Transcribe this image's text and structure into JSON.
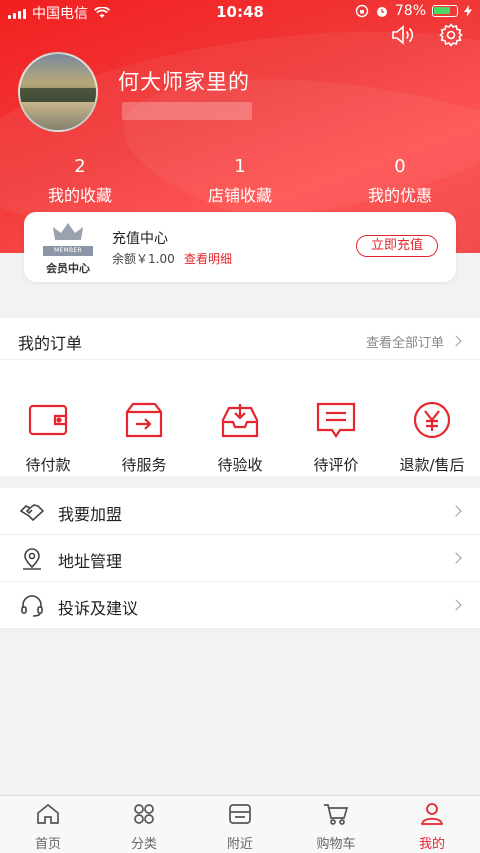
{
  "status_bar": {
    "carrier": "中国电信",
    "time": "10:48",
    "battery": "78%",
    "battery_level": 0.78
  },
  "profile": {
    "username": "何大师家里的"
  },
  "stats": [
    {
      "num": "2",
      "label": "我的收藏"
    },
    {
      "num": "1",
      "label": "店铺收藏"
    },
    {
      "num": "0",
      "label": "我的优惠"
    }
  ],
  "member_card": {
    "ribbon": "MEMBER",
    "label": "会员中心",
    "title": "充值中心",
    "balance": "余额￥1.00",
    "detail_link": "查看明细",
    "recharge_button": "立即充值"
  },
  "orders": {
    "title": "我的订单",
    "view_all": "查看全部订单",
    "items": [
      {
        "label": "待付款",
        "icon": "wallet-icon"
      },
      {
        "label": "待服务",
        "icon": "service-box-icon"
      },
      {
        "label": "待验收",
        "icon": "inbox-download-icon"
      },
      {
        "label": "待评价",
        "icon": "comment-icon"
      },
      {
        "label": "退款/售后",
        "icon": "yen-circle-icon"
      }
    ]
  },
  "menu": [
    {
      "label": "我要加盟",
      "icon": "handshake-icon"
    },
    {
      "label": "地址管理",
      "icon": "location-pin-icon"
    },
    {
      "label": "投诉及建议",
      "icon": "headset-icon"
    }
  ],
  "tabbar": [
    {
      "label": "首页",
      "icon": "home-icon"
    },
    {
      "label": "分类",
      "icon": "category-grid-icon"
    },
    {
      "label": "附近",
      "icon": "nearby-shop-icon"
    },
    {
      "label": "购物车",
      "icon": "cart-icon"
    },
    {
      "label": "我的",
      "icon": "user-icon",
      "active": true
    }
  ],
  "colors": {
    "accent": "#e5262e",
    "header_red": "#f21f1f"
  }
}
